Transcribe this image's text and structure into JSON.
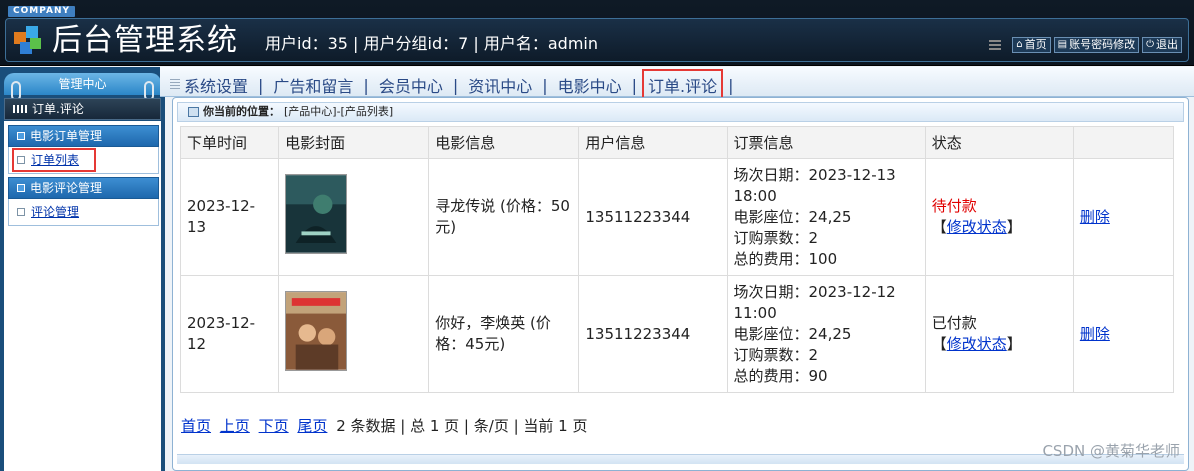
{
  "header": {
    "company": "COMPANY",
    "title": "后台管理系统",
    "user_info": "用户id：35 | 用户分组id：7 | 用户名：admin",
    "links": [
      {
        "label": "首页",
        "icon": "home-icon"
      },
      {
        "label": "账号密码修改",
        "icon": "form-icon"
      },
      {
        "label": "退出",
        "icon": "power-icon"
      }
    ]
  },
  "sidebar": {
    "title": "管理中心",
    "section": "订单.评论",
    "groups": [
      {
        "title": "电影订单管理",
        "items": [
          "订单列表"
        ]
      },
      {
        "title": "电影评论管理",
        "items": [
          "评论管理"
        ]
      }
    ]
  },
  "topnav": {
    "items": [
      "系统设置",
      "广告和留言",
      "会员中心",
      "资讯中心",
      "电影中心",
      "订单.评论"
    ]
  },
  "breadcrumb": {
    "label": "你当前的位置：",
    "path": "[产品中心]-[产品列表]"
  },
  "table": {
    "headers": [
      "下单时间",
      "电影封面",
      "电影信息",
      "用户信息",
      "订票信息",
      "状态",
      ""
    ],
    "rows": [
      {
        "order_time": "2023-12-13",
        "movie_info": "寻龙传说 (价格：50元)",
        "user_info": "13511223344",
        "ticket": {
          "date": "场次日期：2023-12-13 18:00",
          "seat": "电影座位：24,25",
          "count": "订购票数：2",
          "total": "总的费用：100"
        },
        "status": "待付款",
        "status_color": "#e00000",
        "modify_label": "修改状态",
        "delete_label": "删除"
      },
      {
        "order_time": "2023-12-12",
        "movie_info": "你好，李焕英 (价格：45元)",
        "user_info": "13511223344",
        "ticket": {
          "date": "场次日期：2023-12-12 11:00",
          "seat": "电影座位：24,25",
          "count": "订购票数：2",
          "total": "总的费用：90"
        },
        "status": "已付款",
        "status_color": "#222222",
        "modify_label": "修改状态",
        "delete_label": "删除"
      }
    ]
  },
  "pager": {
    "first": "首页",
    "prev": "上页",
    "next": "下页",
    "last": "尾页",
    "summary": "2 条数据 | 总 1 页 | 条/页 | 当前 1 页"
  },
  "watermark": "CSDN @黄菊华老师",
  "colors": {
    "header_bg": "#0f1a26",
    "sidebar_bg": "#1a4e7b",
    "link": "#0033cc",
    "highlight": "#e53935"
  }
}
